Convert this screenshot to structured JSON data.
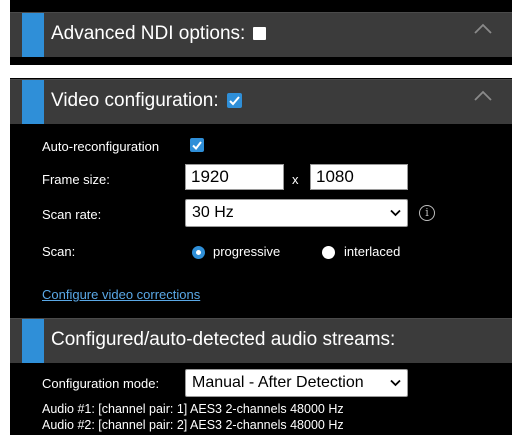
{
  "advanced_ndi": {
    "title": "Advanced NDI options:",
    "checked": false
  },
  "video_config": {
    "title": "Video configuration:",
    "checked": true,
    "auto_reconfig_label": "Auto-reconfiguration",
    "auto_reconfig_checked": true,
    "frame_size_label": "Frame size:",
    "frame_width": "1920",
    "frame_x": "x",
    "frame_height": "1080",
    "scan_rate_label": "Scan rate:",
    "scan_rate_value": "30 Hz",
    "info_icon_glyph": "i",
    "scan_label": "Scan:",
    "scan_options": [
      "progressive",
      "interlaced"
    ],
    "scan_selected": "progressive",
    "corrections_link": "Configure video corrections"
  },
  "audio": {
    "title": "Configured/auto-detected audio streams:",
    "config_mode_label": "Configuration mode:",
    "config_mode_value": "Manual - After Detection",
    "streams": [
      "Audio #1: [channel pair: 1] AES3 2-channels 48000 Hz",
      "Audio #2: [channel pair: 2] AES3 2-channels 48000 Hz"
    ]
  },
  "colors": {
    "accent": "#2f8fd8",
    "header_bg": "#3b3b3b",
    "panel_bg": "#000000",
    "link": "#5aa8e6"
  }
}
